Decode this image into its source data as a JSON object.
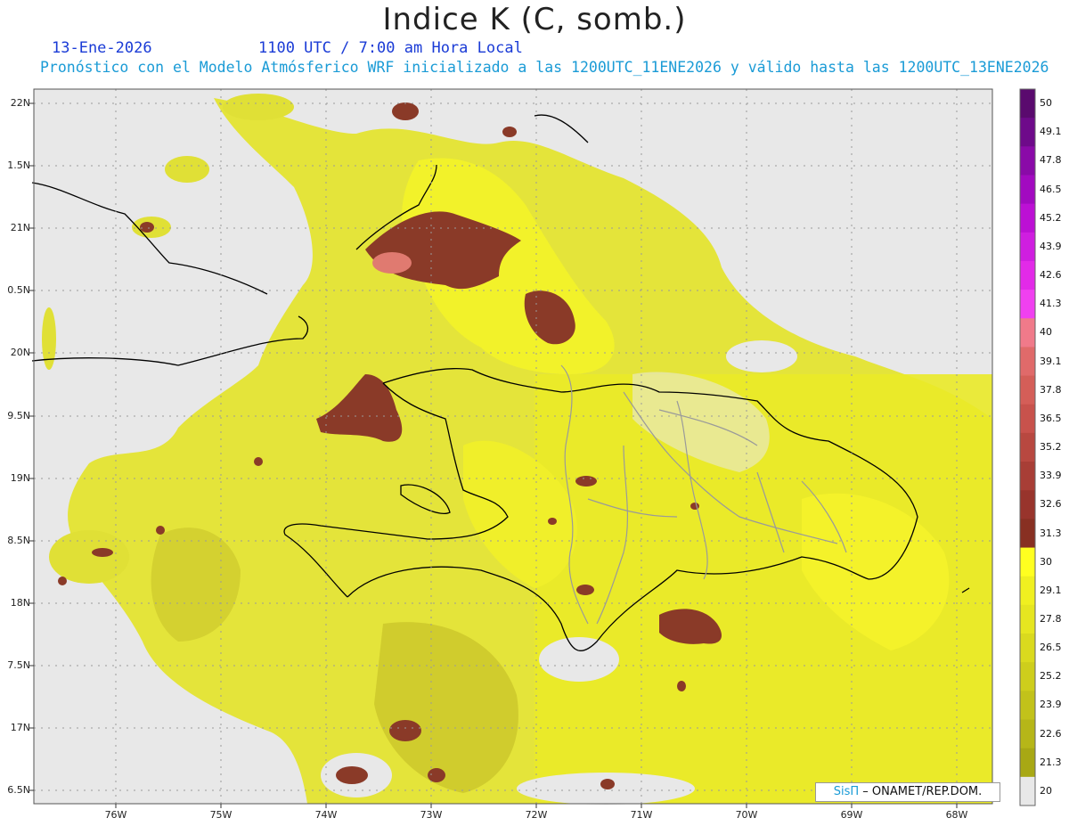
{
  "header": {
    "title": "Indice K (C, somb.)",
    "date": "13-Ene-2026",
    "time": "1100 UTC / 7:00 am Hora Local",
    "description": "Pronóstico con el Modelo Atmósferico WRF inicializado a las 1200UTC_11ENE2026 y válido hasta las  1200UTC_13ENE2026"
  },
  "axes": {
    "lat_labels": [
      "22N",
      "1.5N",
      "21N",
      "0.5N",
      "20N",
      "9.5N",
      "19N",
      "8.5N",
      "18N",
      "7.5N",
      "17N",
      "6.5N"
    ],
    "lon_labels": [
      "76W",
      "75W",
      "74W",
      "73W",
      "72W",
      "71W",
      "70W",
      "69W",
      "68W"
    ]
  },
  "colorbar": {
    "labels": [
      "50",
      "49.1",
      "47.8",
      "46.5",
      "45.2",
      "43.9",
      "42.6",
      "41.3",
      "40",
      "39.1",
      "37.8",
      "36.5",
      "35.2",
      "33.9",
      "32.6",
      "31.3",
      "30",
      "29.1",
      "27.8",
      "26.5",
      "25.2",
      "23.9",
      "22.6",
      "21.3",
      "20"
    ],
    "colors": [
      "#5a0a6e",
      "#6e0a8a",
      "#8a0aa8",
      "#a20ac0",
      "#bc10d4",
      "#cf1ee0",
      "#e22ae8",
      "#f040f0",
      "#f07a8a",
      "#e06a6a",
      "#d45e58",
      "#c8524c",
      "#b84840",
      "#a83e36",
      "#98342c",
      "#883022",
      "#ffff20",
      "#f0f020",
      "#e6e620",
      "#dada1e",
      "#cece1c",
      "#c2c21a",
      "#b6b618",
      "#a8a814",
      "#e8e8e8"
    ]
  },
  "credit": {
    "brand": "SisΠ",
    "text": " – ONAMET/REP.DOM."
  },
  "colors": {
    "land_yellow": "#e6e628",
    "bright_yellow": "#f4f22a",
    "olive": "#c9c42a",
    "brown": "#8a3a28",
    "pink": "#e07a70",
    "background": "#e8e8e8"
  }
}
